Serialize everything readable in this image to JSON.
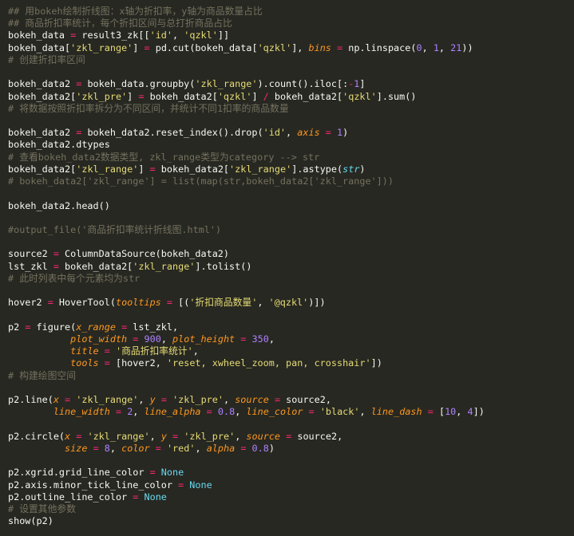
{
  "theme": {
    "background": "#272822",
    "colors": {
      "plain": "#f8f8f2",
      "comment": "#75715e",
      "op": "#f92672",
      "string": "#e6db74",
      "number": "#ae81ff",
      "builtin": "#66d9ef",
      "param": "#fd971f"
    }
  },
  "code_lines": [
    [
      [
        "comment",
        "## 用bokeh绘制折线图：x轴为折扣率，y轴为商品数量占比"
      ]
    ],
    [
      [
        "comment",
        "## 商品折扣率统计，每个折扣区间与总打折商品占比"
      ]
    ],
    [
      [
        "plain",
        "bokeh_data "
      ],
      [
        "op",
        "="
      ],
      [
        "plain",
        " result3_zk[["
      ],
      [
        "string",
        "'id'"
      ],
      [
        "plain",
        ", "
      ],
      [
        "string",
        "'qzkl'"
      ],
      [
        "plain",
        "]]"
      ]
    ],
    [
      [
        "plain",
        "bokeh_data["
      ],
      [
        "string",
        "'zkl_range'"
      ],
      [
        "plain",
        "] "
      ],
      [
        "op",
        "="
      ],
      [
        "plain",
        " pd.cut(bokeh_data["
      ],
      [
        "string",
        "'qzkl'"
      ],
      [
        "plain",
        "], "
      ],
      [
        "param",
        "bins"
      ],
      [
        "plain",
        " "
      ],
      [
        "op",
        "="
      ],
      [
        "plain",
        " np.linspace("
      ],
      [
        "number",
        "0"
      ],
      [
        "plain",
        ", "
      ],
      [
        "number",
        "1"
      ],
      [
        "plain",
        ", "
      ],
      [
        "number",
        "21"
      ],
      [
        "plain",
        "))"
      ]
    ],
    [
      [
        "comment",
        "# 创建折扣率区间"
      ]
    ],
    [],
    [
      [
        "plain",
        "bokeh_data2 "
      ],
      [
        "op",
        "="
      ],
      [
        "plain",
        " bokeh_data.groupby("
      ],
      [
        "string",
        "'zkl_range'"
      ],
      [
        "plain",
        ").count().iloc[:"
      ],
      [
        "op",
        "-"
      ],
      [
        "number",
        "1"
      ],
      [
        "plain",
        "]"
      ]
    ],
    [
      [
        "plain",
        "bokeh_data2["
      ],
      [
        "string",
        "'zkl_pre'"
      ],
      [
        "plain",
        "] "
      ],
      [
        "op",
        "="
      ],
      [
        "plain",
        " bokeh_data2["
      ],
      [
        "string",
        "'qzkl'"
      ],
      [
        "plain",
        "] "
      ],
      [
        "op",
        "/"
      ],
      [
        "plain",
        " bokeh_data2["
      ],
      [
        "string",
        "'qzkl'"
      ],
      [
        "plain",
        "].sum()"
      ]
    ],
    [
      [
        "comment",
        "# 将数据按照折扣率拆分为不同区间，并统计不同1扣率的商品数量"
      ]
    ],
    [],
    [
      [
        "plain",
        "bokeh_data2 "
      ],
      [
        "op",
        "="
      ],
      [
        "plain",
        " bokeh_data2.reset_index().drop("
      ],
      [
        "string",
        "'id'"
      ],
      [
        "plain",
        ", "
      ],
      [
        "param",
        "axis"
      ],
      [
        "plain",
        " "
      ],
      [
        "op",
        "="
      ],
      [
        "plain",
        " "
      ],
      [
        "number",
        "1"
      ],
      [
        "plain",
        ")"
      ]
    ],
    [
      [
        "plain",
        "bokeh_data2.dtypes"
      ]
    ],
    [
      [
        "comment",
        "# 查看bokeh_data2数据类型, zkl_range类型为category --> str"
      ]
    ],
    [
      [
        "plain",
        "bokeh_data2["
      ],
      [
        "string",
        "'zkl_range'"
      ],
      [
        "plain",
        "] "
      ],
      [
        "op",
        "="
      ],
      [
        "plain",
        " bokeh_data2["
      ],
      [
        "string",
        "'zkl_range'"
      ],
      [
        "plain",
        "].astype("
      ],
      [
        "builtin-it",
        "str"
      ],
      [
        "plain",
        ")"
      ]
    ],
    [
      [
        "comment",
        "# bokeh_data2['zkl_range'] = list(map(str,bokeh_data2['zkl_range']))"
      ]
    ],
    [],
    [
      [
        "plain",
        "bokeh_data2.head()"
      ]
    ],
    [],
    [
      [
        "comment",
        "#output_file('商品折扣率统计折线图.html')"
      ]
    ],
    [],
    [
      [
        "plain",
        "source2 "
      ],
      [
        "op",
        "="
      ],
      [
        "plain",
        " ColumnDataSource(bokeh_data2)"
      ]
    ],
    [
      [
        "plain",
        "lst_zkl "
      ],
      [
        "op",
        "="
      ],
      [
        "plain",
        " bokeh_data2["
      ],
      [
        "string",
        "'zkl_range'"
      ],
      [
        "plain",
        "].tolist()"
      ]
    ],
    [
      [
        "comment",
        "# 此时列表中每个元素均为str"
      ]
    ],
    [],
    [
      [
        "plain",
        "hover2 "
      ],
      [
        "op",
        "="
      ],
      [
        "plain",
        " HoverTool("
      ],
      [
        "param",
        "tooltips"
      ],
      [
        "plain",
        " "
      ],
      [
        "op",
        "="
      ],
      [
        "plain",
        " [("
      ],
      [
        "string",
        "'折扣商品数量'"
      ],
      [
        "plain",
        ", "
      ],
      [
        "string",
        "'@qzkl'"
      ],
      [
        "plain",
        ")])"
      ]
    ],
    [],
    [
      [
        "plain",
        "p2 "
      ],
      [
        "op",
        "="
      ],
      [
        "plain",
        " figure("
      ],
      [
        "param",
        "x_range"
      ],
      [
        "plain",
        " "
      ],
      [
        "op",
        "="
      ],
      [
        "plain",
        " lst_zkl,"
      ]
    ],
    [
      [
        "plain",
        "           "
      ],
      [
        "param",
        "plot_width"
      ],
      [
        "plain",
        " "
      ],
      [
        "op",
        "="
      ],
      [
        "plain",
        " "
      ],
      [
        "number",
        "900"
      ],
      [
        "plain",
        ", "
      ],
      [
        "param",
        "plot_height"
      ],
      [
        "plain",
        " "
      ],
      [
        "op",
        "="
      ],
      [
        "plain",
        " "
      ],
      [
        "number",
        "350"
      ],
      [
        "plain",
        ","
      ]
    ],
    [
      [
        "plain",
        "           "
      ],
      [
        "param",
        "title"
      ],
      [
        "plain",
        " "
      ],
      [
        "op",
        "="
      ],
      [
        "plain",
        " "
      ],
      [
        "string",
        "'商品折扣率统计'"
      ],
      [
        "plain",
        ","
      ]
    ],
    [
      [
        "plain",
        "           "
      ],
      [
        "param",
        "tools"
      ],
      [
        "plain",
        " "
      ],
      [
        "op",
        "="
      ],
      [
        "plain",
        " [hover2, "
      ],
      [
        "string",
        "'reset, xwheel_zoom, pan, crosshair'"
      ],
      [
        "plain",
        "])"
      ]
    ],
    [
      [
        "comment",
        "# 构建绘图空间"
      ]
    ],
    [],
    [
      [
        "plain",
        "p2.line("
      ],
      [
        "param",
        "x"
      ],
      [
        "plain",
        " "
      ],
      [
        "op",
        "="
      ],
      [
        "plain",
        " "
      ],
      [
        "string",
        "'zkl_range'"
      ],
      [
        "plain",
        ", "
      ],
      [
        "param",
        "y"
      ],
      [
        "plain",
        " "
      ],
      [
        "op",
        "="
      ],
      [
        "plain",
        " "
      ],
      [
        "string",
        "'zkl_pre'"
      ],
      [
        "plain",
        ", "
      ],
      [
        "param",
        "source"
      ],
      [
        "plain",
        " "
      ],
      [
        "op",
        "="
      ],
      [
        "plain",
        " source2,"
      ]
    ],
    [
      [
        "plain",
        "        "
      ],
      [
        "param",
        "line_width"
      ],
      [
        "plain",
        " "
      ],
      [
        "op",
        "="
      ],
      [
        "plain",
        " "
      ],
      [
        "number",
        "2"
      ],
      [
        "plain",
        ", "
      ],
      [
        "param",
        "line_alpha"
      ],
      [
        "plain",
        " "
      ],
      [
        "op",
        "="
      ],
      [
        "plain",
        " "
      ],
      [
        "number",
        "0.8"
      ],
      [
        "plain",
        ", "
      ],
      [
        "param",
        "line_color"
      ],
      [
        "plain",
        " "
      ],
      [
        "op",
        "="
      ],
      [
        "plain",
        " "
      ],
      [
        "string",
        "'black'"
      ],
      [
        "plain",
        ", "
      ],
      [
        "param",
        "line_dash"
      ],
      [
        "plain",
        " "
      ],
      [
        "op",
        "="
      ],
      [
        "plain",
        " ["
      ],
      [
        "number",
        "10"
      ],
      [
        "plain",
        ", "
      ],
      [
        "number",
        "4"
      ],
      [
        "plain",
        "])"
      ]
    ],
    [],
    [
      [
        "plain",
        "p2.circle("
      ],
      [
        "param",
        "x"
      ],
      [
        "plain",
        " "
      ],
      [
        "op",
        "="
      ],
      [
        "plain",
        " "
      ],
      [
        "string",
        "'zkl_range'"
      ],
      [
        "plain",
        ", "
      ],
      [
        "param",
        "y"
      ],
      [
        "plain",
        " "
      ],
      [
        "op",
        "="
      ],
      [
        "plain",
        " "
      ],
      [
        "string",
        "'zkl_pre'"
      ],
      [
        "plain",
        ", "
      ],
      [
        "param",
        "source"
      ],
      [
        "plain",
        " "
      ],
      [
        "op",
        "="
      ],
      [
        "plain",
        " source2,"
      ]
    ],
    [
      [
        "plain",
        "          "
      ],
      [
        "param",
        "size"
      ],
      [
        "plain",
        " "
      ],
      [
        "op",
        "="
      ],
      [
        "plain",
        " "
      ],
      [
        "number",
        "8"
      ],
      [
        "plain",
        ", "
      ],
      [
        "param",
        "color"
      ],
      [
        "plain",
        " "
      ],
      [
        "op",
        "="
      ],
      [
        "plain",
        " "
      ],
      [
        "string",
        "'red'"
      ],
      [
        "plain",
        ", "
      ],
      [
        "param",
        "alpha"
      ],
      [
        "plain",
        " "
      ],
      [
        "op",
        "="
      ],
      [
        "plain",
        " "
      ],
      [
        "number",
        "0.8"
      ],
      [
        "plain",
        ")"
      ]
    ],
    [],
    [
      [
        "plain",
        "p2.xgrid.grid_line_color "
      ],
      [
        "op",
        "="
      ],
      [
        "plain",
        " "
      ],
      [
        "builtin",
        "None"
      ]
    ],
    [
      [
        "plain",
        "p2.axis.minor_tick_line_color "
      ],
      [
        "op",
        "="
      ],
      [
        "plain",
        " "
      ],
      [
        "builtin",
        "None"
      ]
    ],
    [
      [
        "plain",
        "p2.outline_line_color "
      ],
      [
        "op",
        "="
      ],
      [
        "plain",
        " "
      ],
      [
        "builtin",
        "None"
      ]
    ],
    [
      [
        "comment",
        "# 设置其他参数"
      ]
    ],
    [
      [
        "plain",
        "show(p2)"
      ]
    ]
  ]
}
